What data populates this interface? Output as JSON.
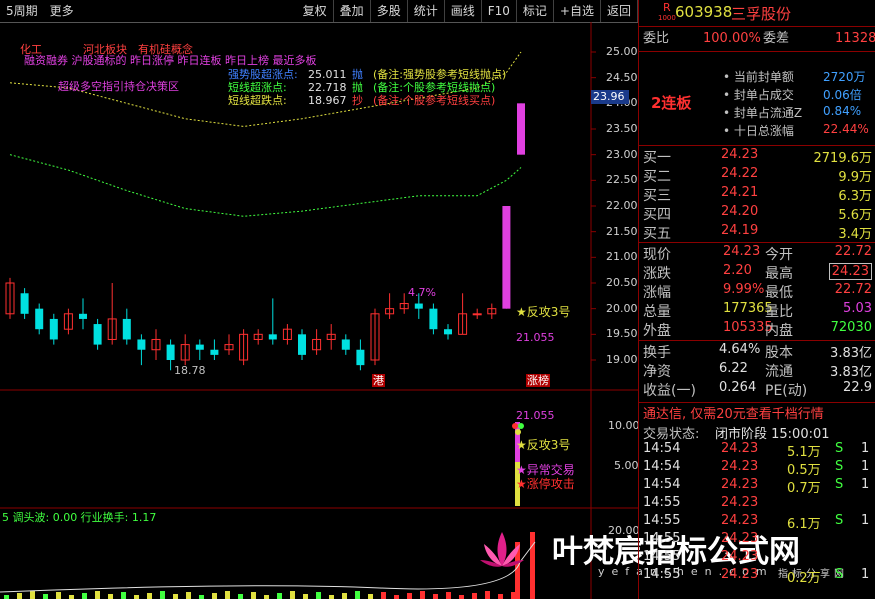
{
  "toolbar": {
    "left": [
      "5周期",
      "更多"
    ],
    "right": [
      "复权",
      "叠加",
      "多股",
      "统计",
      "画线",
      "F10",
      "标记",
      "+自选",
      "返回"
    ]
  },
  "annotations": {
    "line1": "化工",
    "line1b": "河北板块",
    "line1c": "有机硅概念",
    "line2": "融资融券 沪股通标的 昨日涨停 昨日连板 昨日上榜 最近多板",
    "line3": "超级多空指引持仓决策区",
    "legend": [
      {
        "name": "强势股超涨点:",
        "value": "25.011",
        "tag": "抛",
        "note": "(备注:强势股参考短线抛点)"
      },
      {
        "name": "短线超涨点:",
        "value": "22.718",
        "tag": "抛",
        "note": "(备注:个股参考短线抛点)"
      },
      {
        "name": "短线超跌点:",
        "value": "18.967",
        "tag": "抄",
        "note": "(备注:个股参考短线买点)"
      }
    ],
    "pct_label": "4.7%",
    "low_label": "18.78",
    "attack_label": "反攻3号",
    "attack_value": "21.055",
    "gang_label": "港",
    "zhangting_tag": "涨榜",
    "sub_value": "21.055",
    "sub_attack": "反攻3号",
    "sub_abnormal": "异常交易",
    "sub_limit": "涨停攻击",
    "bottom_indicator": "5 调头波: 0.00 行业换手: 1.17"
  },
  "price_axis": [
    "25.00",
    "24.50",
    "24.00",
    "23.50",
    "23.00",
    "22.50",
    "22.00",
    "21.50",
    "21.00",
    "20.50",
    "20.00",
    "19.50",
    "19.00"
  ],
  "price_marker": "23.96",
  "sub_axis": [
    "10.00",
    "5.00"
  ],
  "bottom_axis": [
    "20.00"
  ],
  "watermark": {
    "cn": "叶梵宸指标公式网",
    "url": "yefanchen.com",
    "sub": "指标分享网"
  },
  "chart_data": {
    "type": "candlestick",
    "y_range": [
      18.6,
      25.3
    ],
    "candles": [
      [
        19.9,
        20.5,
        19.8,
        20.6
      ],
      [
        20.3,
        19.9,
        19.8,
        20.4
      ],
      [
        20.0,
        19.6,
        19.5,
        20.1
      ],
      [
        19.8,
        19.4,
        19.3,
        19.9
      ],
      [
        19.6,
        19.9,
        19.5,
        20.0
      ],
      [
        19.9,
        19.8,
        19.6,
        20.2
      ],
      [
        19.7,
        19.3,
        19.2,
        19.8
      ],
      [
        19.4,
        19.8,
        19.3,
        20.5
      ],
      [
        19.8,
        19.4,
        19.3,
        20.0
      ],
      [
        19.4,
        19.2,
        18.9,
        19.5
      ],
      [
        19.2,
        19.4,
        19.0,
        19.6
      ],
      [
        19.3,
        19.0,
        18.8,
        19.4
      ],
      [
        19.0,
        19.3,
        18.9,
        19.5
      ],
      [
        19.3,
        19.2,
        19.0,
        19.4
      ],
      [
        19.2,
        19.1,
        19.0,
        19.4
      ],
      [
        19.2,
        19.3,
        19.1,
        19.5
      ],
      [
        19.0,
        19.5,
        18.9,
        19.6
      ],
      [
        19.4,
        19.5,
        19.3,
        19.6
      ],
      [
        19.5,
        19.4,
        19.3,
        20.2
      ],
      [
        19.4,
        19.6,
        19.3,
        19.7
      ],
      [
        19.5,
        19.1,
        19.0,
        19.6
      ],
      [
        19.2,
        19.4,
        19.1,
        19.6
      ],
      [
        19.4,
        19.5,
        19.2,
        19.7
      ],
      [
        19.4,
        19.2,
        19.1,
        19.5
      ],
      [
        19.2,
        18.9,
        18.8,
        19.4
      ],
      [
        19.0,
        19.9,
        18.9,
        20.0
      ],
      [
        19.9,
        20.0,
        19.8,
        20.3
      ],
      [
        20.0,
        20.1,
        19.9,
        20.3
      ],
      [
        20.1,
        20.0,
        19.8,
        20.3
      ],
      [
        20.0,
        19.6,
        19.5,
        20.1
      ],
      [
        19.6,
        19.5,
        19.4,
        19.7
      ],
      [
        19.5,
        19.9,
        19.5,
        20.3
      ],
      [
        19.9,
        19.9,
        19.8,
        20.0
      ],
      [
        19.9,
        20.0,
        19.8,
        20.1
      ],
      [
        20.0,
        22.0,
        20.0,
        22.0
      ],
      [
        23.0,
        24.0,
        23.0,
        24.0
      ]
    ],
    "line_up": [
      [
        0,
        24.4
      ],
      [
        4,
        24.3
      ],
      [
        8,
        24.0
      ],
      [
        12,
        23.7
      ],
      [
        16,
        23.55
      ],
      [
        20,
        23.7
      ],
      [
        24,
        23.9
      ],
      [
        28,
        24.1
      ],
      [
        32,
        24.3
      ],
      [
        34,
        24.6
      ],
      [
        35,
        25.0
      ]
    ],
    "line_mid": [
      [
        0,
        23.0
      ],
      [
        4,
        22.7
      ],
      [
        8,
        22.3
      ],
      [
        12,
        21.95
      ],
      [
        16,
        21.8
      ],
      [
        20,
        21.9
      ],
      [
        24,
        22.05
      ],
      [
        28,
        22.2
      ],
      [
        32,
        22.2
      ],
      [
        34,
        22.5
      ],
      [
        35,
        22.75
      ]
    ]
  },
  "quote": {
    "code": "603938",
    "name": "三孚股份",
    "badge_r": "R",
    "badge_num": "1000",
    "weibi_label": "委比",
    "weibi_value": "100.00%",
    "weicha_label": "委差",
    "weicha_value": "11328",
    "seal": [
      {
        "label": "当前封单额",
        "value": "2720万"
      },
      {
        "label": "封单占成交",
        "value": "0.06倍"
      },
      {
        "label": "封单占流通Z",
        "value": "0.84%"
      },
      {
        "label": "十日总涨幅",
        "value": "22.44%"
      }
    ],
    "lianban": "2连板",
    "bids": [
      {
        "label": "买一",
        "price": "24.23",
        "vol": "2719.6万"
      },
      {
        "label": "买二",
        "price": "24.22",
        "vol": "9.9万"
      },
      {
        "label": "买三",
        "price": "24.21",
        "vol": "6.3万"
      },
      {
        "label": "买四",
        "price": "24.20",
        "vol": "5.6万"
      },
      {
        "label": "买五",
        "price": "24.19",
        "vol": "3.4万"
      }
    ],
    "stats": [
      {
        "l1": "现价",
        "v1": "24.23",
        "l2": "今开",
        "v2": "22.72"
      },
      {
        "l1": "涨跌",
        "v1": "2.20",
        "l2": "最高",
        "v2": "24.23"
      },
      {
        "l1": "涨幅",
        "v1": "9.99%",
        "l2": "最低",
        "v2": "22.72"
      },
      {
        "l1": "总量",
        "v1": "177365",
        "l2": "量比",
        "v2": "5.03"
      },
      {
        "l1": "外盘",
        "v1": "105335",
        "l2": "内盘",
        "v2": "72030"
      }
    ],
    "stats2": [
      {
        "l1": "换手",
        "v1": "4.64%",
        "l2": "股本",
        "v2": "3.83亿"
      },
      {
        "l1": "净资",
        "v1": "6.22",
        "l2": "流通",
        "v2": "3.83亿"
      },
      {
        "l1": "收益(一)",
        "v1": "0.264",
        "l2": "PE(动)",
        "v2": "22.9"
      }
    ],
    "promo": "通达信, 仅需20元查看千档行情",
    "status_label": "交易状态:",
    "status_value": "闭市阶段 15:00:01",
    "ticks": [
      {
        "t": "14:54",
        "p": "24.23",
        "v": "5.1万",
        "s": "S",
        "n": "1"
      },
      {
        "t": "14:54",
        "p": "24.23",
        "v": "0.5万",
        "s": "S",
        "n": "1"
      },
      {
        "t": "14:54",
        "p": "24.23",
        "v": "0.7万",
        "s": "S",
        "n": "1"
      },
      {
        "t": "14:55",
        "p": "24.23",
        "v": "",
        "s": "",
        "n": ""
      },
      {
        "t": "14:55",
        "p": "24.23",
        "v": "6.1万",
        "s": "S",
        "n": "1"
      },
      {
        "t": "14:55",
        "p": "24.23",
        "v": "",
        "s": "",
        "n": ""
      },
      {
        "t": "14:55",
        "p": "24.23",
        "v": "",
        "s": "",
        "n": ""
      },
      {
        "t": "14:55",
        "p": "24.23",
        "v": "0.2万",
        "s": "S",
        "n": "1"
      }
    ]
  }
}
